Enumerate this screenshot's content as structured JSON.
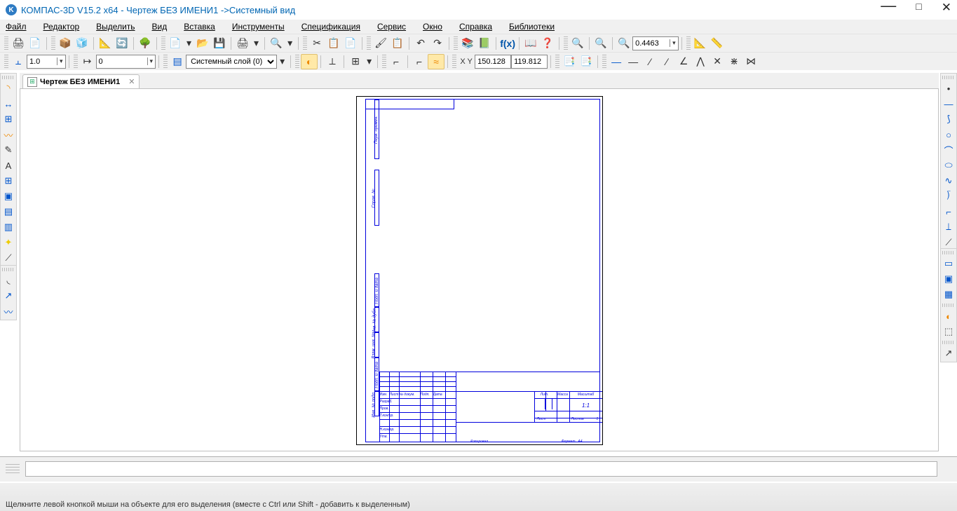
{
  "title": "КОМПАС-3D V15.2  x64 - Чертеж БЕЗ ИМЕНИ1 ->Системный вид",
  "menu": {
    "file": "Файл",
    "edit": "Редактор",
    "select": "Выделить",
    "view": "Вид",
    "insert": "Вставка",
    "tools": "Инструменты",
    "spec": "Спецификация",
    "service": "Сервис",
    "window": "Окно",
    "help": "Справка",
    "libs": "Библиотеки"
  },
  "toolbar2": {
    "line_width": "1.0",
    "step_value": "0",
    "layer_label": "Системный слой (0)",
    "coord_x": "150.128",
    "coord_y": "119.812"
  },
  "zoom": "0.4463",
  "tab": {
    "label": "Чертеж БЕЗ ИМЕНИ1"
  },
  "titleblock": {
    "cols": [
      "Изм.",
      "Лист",
      "№ докум.",
      "Подп.",
      "Дата"
    ],
    "rows": [
      "Разраб.",
      "Пров.",
      "Т.контр.",
      "Н.контр.",
      "Утв."
    ],
    "lit": "Лит.",
    "massa": "Масса",
    "mash": "Масштаб",
    "scale": "1:1",
    "list": "Лист",
    "listov": "Листов",
    "listov_n": "1",
    "side1": "Перв. примен.",
    "side2": "Справ. №",
    "side3": "Подп. и дата",
    "side4": "Инв. № дубл.",
    "side5": "Взам. инв. №",
    "side6": "Подп. и дата",
    "side7": "Инв. № подл.",
    "copy": "Копировал",
    "format": "Формат",
    "format_v": "A4"
  },
  "status": "Щелкните левой кнопкой мыши на объекте для его выделения (вместе с Ctrl или Shift - добавить к выделенным)"
}
